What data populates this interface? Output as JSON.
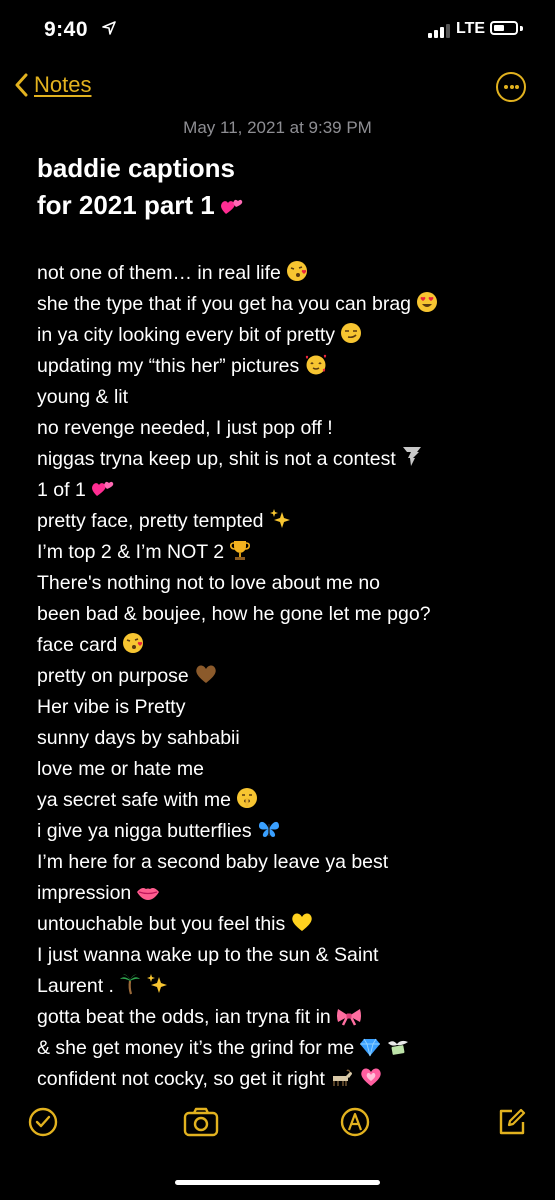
{
  "status_bar": {
    "time": "9:40",
    "network": "LTE"
  },
  "nav": {
    "back_label": "Notes",
    "back_icon": "chevron-left-icon",
    "more_icon": "ellipsis-circle-icon"
  },
  "note": {
    "date": "May 11, 2021 at 9:39 PM",
    "title_lines": [
      "baddie captions",
      "for 2021 part 1"
    ],
    "lines": [
      "not one of them… in real life",
      "she the type that if you get ha you can brag",
      "in ya city looking every bit of pretty",
      "updating my “this her” pictures",
      "young & lit",
      "no revenge needed, I just pop off !",
      "niggas tryna keep up, shit is not a contest",
      "1 of 1",
      "pretty face, pretty tempted",
      "I’m top 2 & I’m NOT 2",
      "There's nothing not to love about me no",
      "been bad & boujee, how he gone let me pgo?",
      "face card",
      "pretty on purpose",
      "Her vibe is Pretty",
      "sunny days by sahbabii",
      "love me or hate me",
      "ya secret safe with me",
      "i give ya nigga butterflies",
      "I’m here for a second baby leave ya best",
      "impression",
      "untouchable but you feel this",
      "I just wanna wake up to the sun & Saint",
      "Laurent .",
      "gotta beat the odds, ian tryna fit in",
      "& she get money it’s the grind for me",
      "confident not cocky, so get it right"
    ]
  },
  "toolbar": {
    "icons": [
      "checklist-icon",
      "camera-icon",
      "markup-icon",
      "compose-icon"
    ]
  },
  "colors": {
    "accent": "#e2b21f",
    "background": "#000000",
    "date": "#8e8e93"
  }
}
